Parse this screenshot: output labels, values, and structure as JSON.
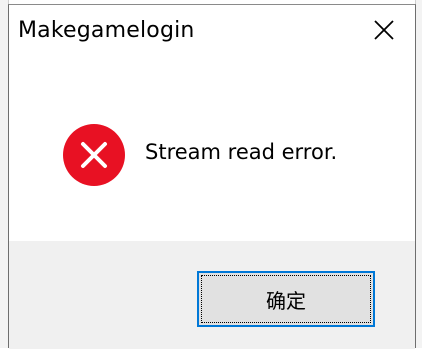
{
  "dialog": {
    "title": "Makegamelogin",
    "message": "Stream read error.",
    "buttons": {
      "ok_label": "确定"
    },
    "icons": {
      "close": "close-icon",
      "status": "error-icon"
    }
  },
  "colors": {
    "error_red": "#e81123",
    "focus_blue": "#0078d7",
    "footer_bg": "#f0f0f0",
    "button_bg": "#e1e1e1"
  }
}
